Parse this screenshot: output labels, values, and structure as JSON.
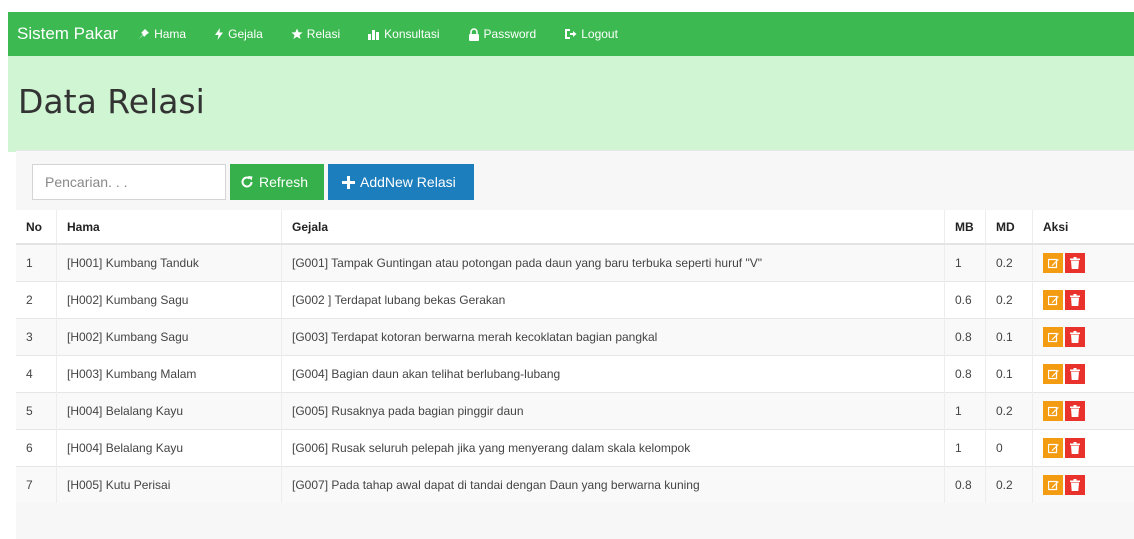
{
  "navbar": {
    "brand": "Sistem Pakar",
    "items": [
      {
        "label": "Hama",
        "icon": "pushpin-icon"
      },
      {
        "label": "Gejala",
        "icon": "flash-icon"
      },
      {
        "label": "Relasi",
        "icon": "star-icon"
      },
      {
        "label": "Konsultasi",
        "icon": "bar-chart-icon"
      },
      {
        "label": "Password",
        "icon": "lock-icon"
      },
      {
        "label": "Logout",
        "icon": "logout-icon"
      }
    ]
  },
  "page": {
    "title": "Data Relasi"
  },
  "toolbar": {
    "search_placeholder": "Pencarian. . .",
    "refresh_label": "Refresh",
    "add_label": "AddNew Relasi"
  },
  "table": {
    "headers": {
      "no": "No",
      "hama": "Hama",
      "gejala": "Gejala",
      "mb": "MB",
      "md": "MD",
      "aksi": "Aksi"
    },
    "rows": [
      {
        "no": "1",
        "hama": "[H001] Kumbang Tanduk",
        "gejala": "[G001] Tampak Guntingan atau potongan pada daun yang baru terbuka seperti huruf \"V\"",
        "mb": "1",
        "md": "0.2"
      },
      {
        "no": "2",
        "hama": "[H002] Kumbang Sagu",
        "gejala": "[G002 ] Terdapat lubang bekas Gerakan",
        "mb": "0.6",
        "md": "0.2"
      },
      {
        "no": "3",
        "hama": "[H002] Kumbang Sagu",
        "gejala": "[G003] Terdapat kotoran berwarna merah kecoklatan bagian pangkal",
        "mb": "0.8",
        "md": "0.1"
      },
      {
        "no": "4",
        "hama": "[H003] Kumbang Malam",
        "gejala": "[G004] Bagian daun akan telihat berlubang-lubang",
        "mb": "0.8",
        "md": "0.1"
      },
      {
        "no": "5",
        "hama": "[H004] Belalang Kayu",
        "gejala": "[G005] Rusaknya pada bagian pinggir daun",
        "mb": "1",
        "md": "0.2"
      },
      {
        "no": "6",
        "hama": "[H004] Belalang Kayu",
        "gejala": "[G006] Rusak seluruh pelepah jika yang menyerang dalam skala kelompok",
        "mb": "1",
        "md": "0"
      },
      {
        "no": "7",
        "hama": "[H005] Kutu Perisai",
        "gejala": "[G007] Pada tahap awal dapat di tandai dengan Daun yang berwarna kuning",
        "mb": "0.8",
        "md": "0.2"
      }
    ]
  },
  "colors": {
    "navbar": "#3cb950",
    "hero": "#cff5d3",
    "refresh": "#36b04a",
    "add": "#1d7ebd",
    "edit": "#f39c12",
    "delete": "#e8322b"
  }
}
